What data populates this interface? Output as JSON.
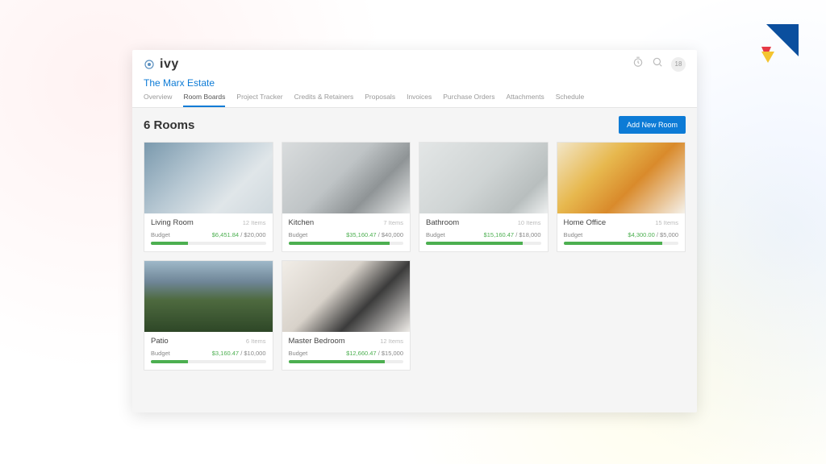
{
  "brand": {
    "name": "ivy",
    "avatar_initials": "18"
  },
  "project": {
    "title": "The Marx Estate"
  },
  "tabs": [
    {
      "label": "Overview",
      "active": false
    },
    {
      "label": "Room Boards",
      "active": true
    },
    {
      "label": "Project Tracker",
      "active": false
    },
    {
      "label": "Credits & Retainers",
      "active": false
    },
    {
      "label": "Proposals",
      "active": false
    },
    {
      "label": "Invoices",
      "active": false
    },
    {
      "label": "Purchase Orders",
      "active": false
    },
    {
      "label": "Attachments",
      "active": false
    },
    {
      "label": "Schedule",
      "active": false
    }
  ],
  "page": {
    "heading": "6 Rooms",
    "add_button": "Add New Room"
  },
  "budget_label": "Budget",
  "rooms": [
    {
      "name": "Living Room",
      "items": "12 Items",
      "spent": "$6,451.84",
      "total": "$20,000",
      "pct": 32,
      "img": "img-living"
    },
    {
      "name": "Kitchen",
      "items": "7 Items",
      "spent": "$35,160.47",
      "total": "$40,000",
      "pct": 88,
      "img": "img-kitchen"
    },
    {
      "name": "Bathroom",
      "items": "10 Items",
      "spent": "$15,160.47",
      "total": "$18,000",
      "pct": 84,
      "img": "img-bathroom"
    },
    {
      "name": "Home Office",
      "items": "15 Items",
      "spent": "$4,300.00",
      "total": "$5,000",
      "pct": 86,
      "img": "img-office"
    },
    {
      "name": "Patio",
      "items": "6 Items",
      "spent": "$3,160.47",
      "total": "$10,000",
      "pct": 32,
      "img": "img-patio"
    },
    {
      "name": "Master Bedroom",
      "items": "12 Items",
      "spent": "$12,660.47",
      "total": "$15,000",
      "pct": 84,
      "img": "img-master"
    }
  ]
}
